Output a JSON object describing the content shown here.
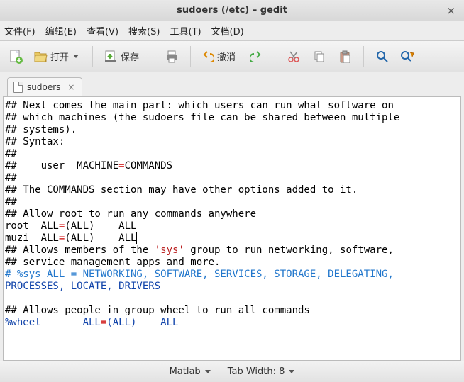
{
  "window": {
    "title": "sudoers (/etc) – gedit",
    "close": "×"
  },
  "menu": {
    "file": "文件(F)",
    "edit": "编辑(E)",
    "view": "查看(V)",
    "search": "搜索(S)",
    "tools": "工具(T)",
    "documents": "文档(D)"
  },
  "toolbar": {
    "open": "打开",
    "save": "保存",
    "undo": "撤消"
  },
  "tab": {
    "name": "sudoers",
    "close": "×"
  },
  "status": {
    "lang": "Matlab",
    "tabwidth": "Tab Width: 8"
  },
  "lines": [
    [
      {
        "c": "g",
        "t": "## Next comes the main part: which users can run what software on"
      }
    ],
    [
      {
        "c": "g",
        "t": "## which machines (the sudoers file can be shared between multiple"
      }
    ],
    [
      {
        "c": "g",
        "t": "## systems)."
      }
    ],
    [
      {
        "c": "g",
        "t": "## Syntax:"
      }
    ],
    [
      {
        "c": "g",
        "t": "##"
      }
    ],
    [
      {
        "c": "g",
        "t": "##    user  MACHINE"
      },
      {
        "c": "eq",
        "t": "="
      },
      {
        "c": "g",
        "t": "COMMANDS"
      }
    ],
    [
      {
        "c": "g",
        "t": "##"
      }
    ],
    [
      {
        "c": "g",
        "t": "## The COMMANDS section may have other options added to it."
      }
    ],
    [
      {
        "c": "g",
        "t": "##"
      }
    ],
    [
      {
        "c": "g",
        "t": "## Allow root to run any commands anywhere"
      }
    ],
    [
      {
        "c": "g",
        "t": "root  ALL"
      },
      {
        "c": "eq",
        "t": "="
      },
      {
        "c": "g",
        "t": "(ALL)    ALL"
      }
    ],
    [
      {
        "c": "g",
        "t": "muzi  ALL"
      },
      {
        "c": "eq",
        "t": "="
      },
      {
        "c": "g",
        "t": "(ALL)    ALL"
      },
      {
        "c": "cursor",
        "t": ""
      }
    ],
    [
      {
        "c": "g",
        "t": "## Allows members of the "
      },
      {
        "c": "str",
        "t": "'sys'"
      },
      {
        "c": "g",
        "t": " group to run networking, software,"
      }
    ],
    [
      {
        "c": "g",
        "t": "## service management apps and more."
      }
    ],
    [
      {
        "c": "cmt",
        "t": "# %sys ALL = NETWORKING, SOFTWARE, SERVICES, STORAGE, DELEGATING,"
      }
    ],
    [
      {
        "c": "kw",
        "t": "PROCESSES, LOCATE, DRIVERS"
      }
    ],
    [
      {
        "c": "g",
        "t": ""
      }
    ],
    [
      {
        "c": "g",
        "t": "## Allows people in group wheel to run all commands"
      }
    ],
    [
      {
        "c": "kw",
        "t": "%wheel       ALL"
      },
      {
        "c": "eq",
        "t": "="
      },
      {
        "c": "kw",
        "t": "(ALL)    ALL"
      }
    ]
  ]
}
